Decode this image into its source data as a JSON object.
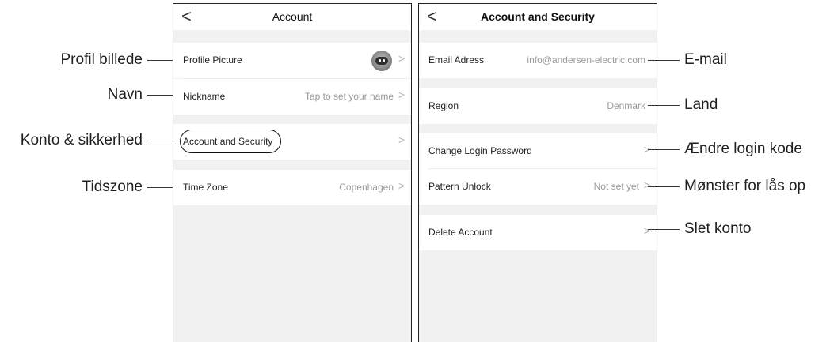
{
  "left_screen": {
    "title": "Account",
    "back_glyph": "<",
    "rows": [
      {
        "label": "Profile Picture",
        "value": "",
        "icon": "avatar-robot"
      },
      {
        "label": "Nickname",
        "value": "Tap to set your name"
      },
      {
        "label": "Account and Security",
        "value": ""
      },
      {
        "label": "Time Zone",
        "value": "Copenhagen"
      }
    ]
  },
  "right_screen": {
    "title": "Account and Security",
    "back_glyph": "<",
    "rows": [
      {
        "label": "Email Adress",
        "value": "info@andersen-electric.com"
      },
      {
        "label": "Region",
        "value": "Denmark"
      },
      {
        "label": "Change Login Password",
        "value": ""
      },
      {
        "label": "Pattern Unlock",
        "value": "Not set yet"
      },
      {
        "label": "Delete Account",
        "value": ""
      }
    ]
  },
  "chevron_glyph": ">",
  "annotations_left": [
    "Profil billede",
    "Navn",
    "Konto & sikkerhed",
    "Tidszone"
  ],
  "annotations_right": [
    "E-mail",
    "Land",
    "Ændre login kode",
    "Mønster for lås op",
    "Slet konto"
  ],
  "colors": {
    "background": "#f1f1f1",
    "row": "#ffffff",
    "value_text": "#9a9a9a",
    "border": "#222222"
  }
}
